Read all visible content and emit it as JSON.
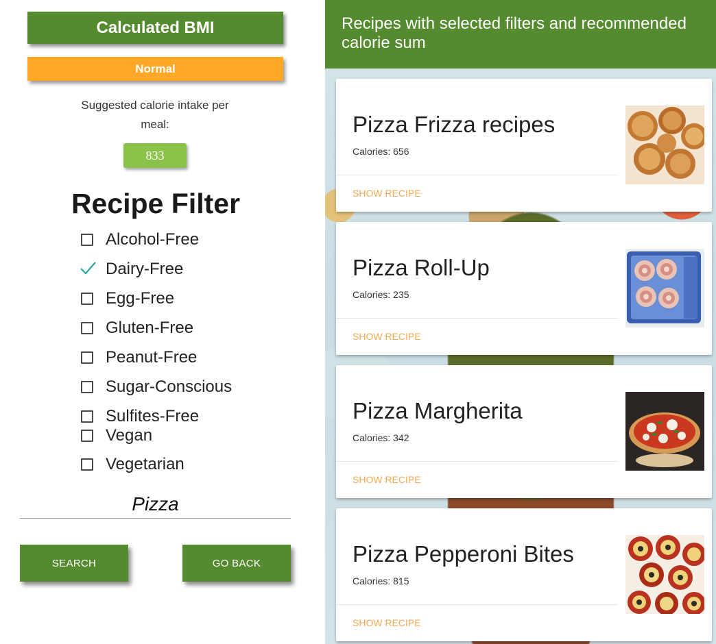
{
  "bmi": {
    "title": "Calculated BMI",
    "status": "Normal",
    "calorie_label": "Suggested calorie intake per meal:",
    "calorie_value": "833",
    "colors": {
      "title_bg": "#558b2f",
      "status_bg": "#ffa726",
      "calorie_bg": "#8bc34a"
    }
  },
  "filter": {
    "title": "Recipe Filter",
    "items": [
      {
        "label": "Alcohol-Free",
        "checked": false
      },
      {
        "label": "Dairy-Free",
        "checked": true
      },
      {
        "label": "Egg-Free",
        "checked": false
      },
      {
        "label": "Gluten-Free",
        "checked": false
      },
      {
        "label": "Peanut-Free",
        "checked": false
      },
      {
        "label": "Sugar-Conscious",
        "checked": false
      },
      {
        "label": "Sulfites-Free",
        "checked": false
      },
      {
        "label": "Vegan",
        "checked": false
      },
      {
        "label": "Vegetarian",
        "checked": false
      }
    ],
    "check_color": "#26a69a"
  },
  "search": {
    "value": "Pizza",
    "search_label": "SEARCH",
    "back_label": "GO BACK"
  },
  "results": {
    "header": "Recipes with selected filters and recommended calorie sum",
    "link_color": "#f3a953",
    "cards": [
      {
        "title": "Pizza Frizza recipes",
        "calories": "Calories: 656",
        "link": "SHOW RECIPE",
        "image": "fried-dough-balls-photo"
      },
      {
        "title": "Pizza Roll-Up",
        "calories": "Calories: 235",
        "link": "SHOW RECIPE",
        "image": "pizza-rolls-tray-photo"
      },
      {
        "title": "Pizza Margherita",
        "calories": "Calories: 342",
        "link": "SHOW RECIPE",
        "image": "margherita-pizza-photo"
      },
      {
        "title": "Pizza Pepperoni Bites",
        "calories": "Calories: 815",
        "link": "SHOW RECIPE",
        "image": "pepperoni-cups-photo"
      }
    ]
  }
}
